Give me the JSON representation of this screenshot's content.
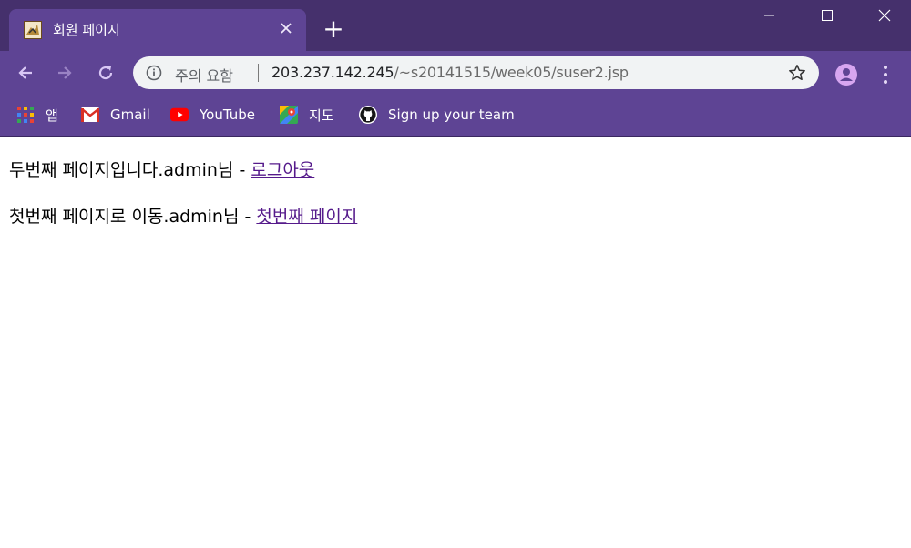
{
  "window": {
    "tab_title": "회원 페이지",
    "new_tab_symbol": "+",
    "controls": {
      "minimize": "minimize-icon",
      "maximize": "maximize-icon",
      "close": "close-icon"
    },
    "theme_color": "#4a3473"
  },
  "toolbar": {
    "security_label": "주의 요함",
    "url_host": "203.237.142.245",
    "url_path": "/~s20141515/week05/suser2.jsp"
  },
  "bookmarks": [
    {
      "label": "앱",
      "icon": "apps-grid-icon"
    },
    {
      "label": "Gmail",
      "icon": "gmail-icon"
    },
    {
      "label": "YouTube",
      "icon": "youtube-icon"
    },
    {
      "label": "지도",
      "icon": "maps-icon"
    },
    {
      "label": "Sign up your team",
      "icon": "github-icon"
    }
  ],
  "page": {
    "line1_text": "두번째 페이지입니다.admin님 - ",
    "line1_link": "로그아웃",
    "line2_text": "첫번째 페이지로 이동.admin님 - ",
    "line2_link": "첫번째 페이지",
    "link_color": "#551a8b"
  }
}
